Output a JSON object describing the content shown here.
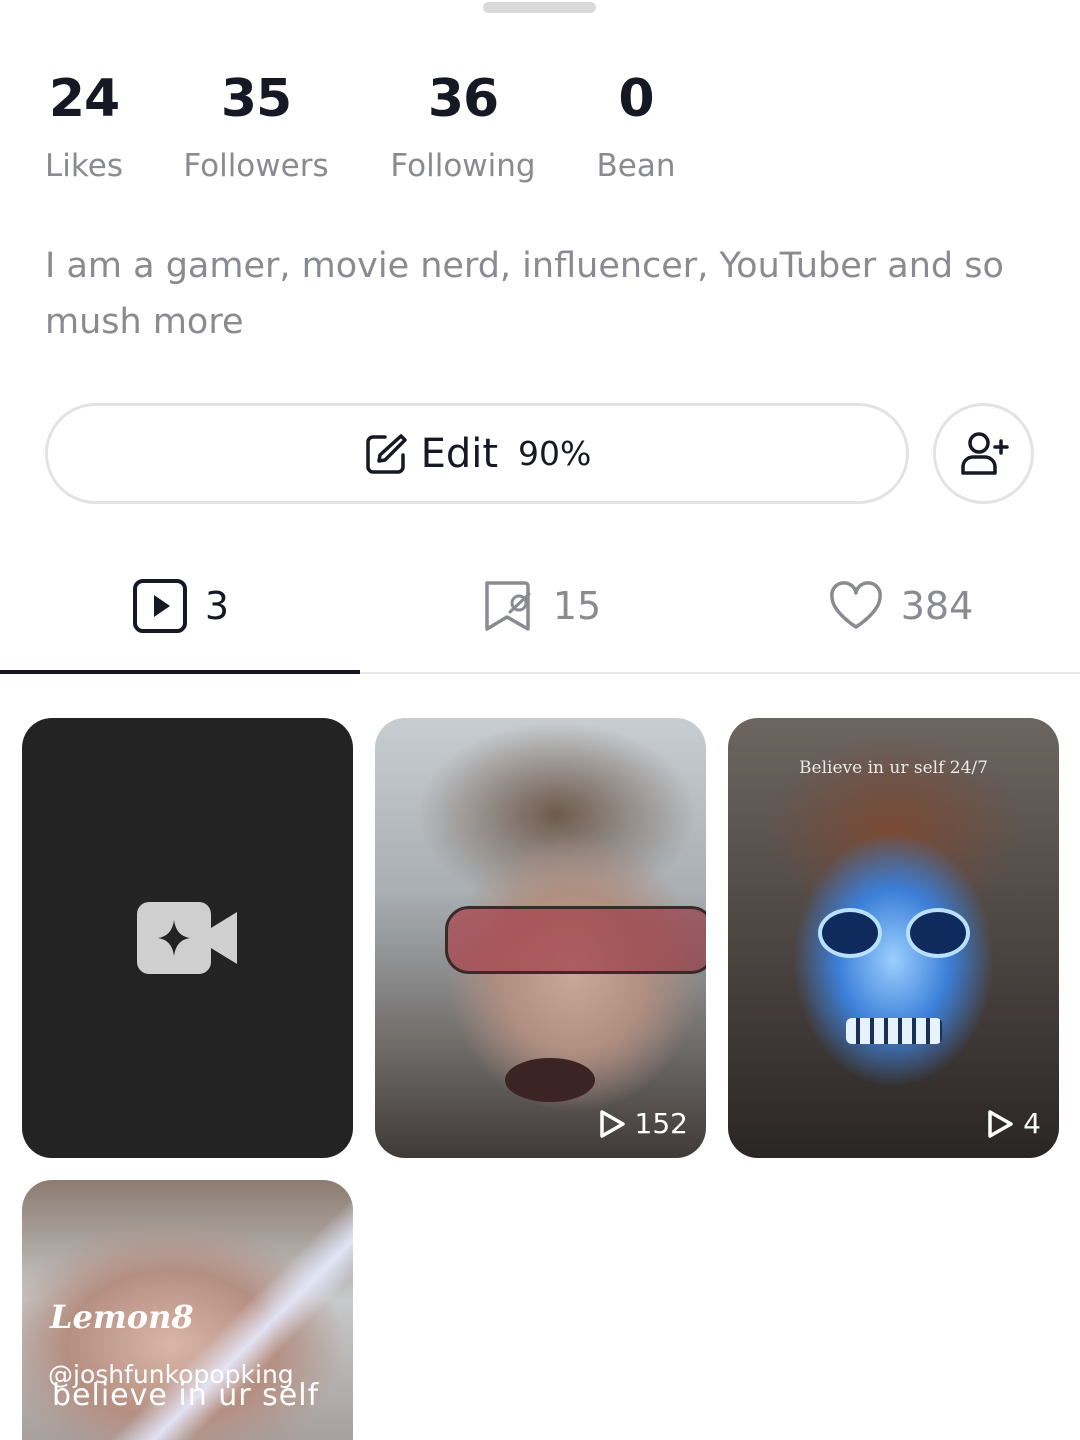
{
  "stats": [
    {
      "value": "24",
      "label": "Likes"
    },
    {
      "value": "35",
      "label": "Followers"
    },
    {
      "value": "36",
      "label": "Following"
    },
    {
      "value": "0",
      "label": "Bean"
    }
  ],
  "bio": "I am a gamer, movie nerd, influencer, YouTuber and so mush more",
  "actions": {
    "edit_label": "Edit",
    "edit_progress": "90%",
    "edit_icon": "edit-icon",
    "add_friend_icon": "add-friend-icon"
  },
  "tabs": [
    {
      "icon": "video-icon",
      "count": "3",
      "active": true
    },
    {
      "icon": "saved-icon",
      "count": "15",
      "active": false
    },
    {
      "icon": "heart-icon",
      "count": "384",
      "active": false
    }
  ],
  "grid": {
    "create_icon": "create-video-icon",
    "items": [
      {
        "views": "152"
      },
      {
        "views": "4",
        "caption": "Believe in ur self 24/7"
      },
      {
        "brand": "Lemon8",
        "handle": "@joshfunkopopking",
        "slogan": "believe in ur self"
      }
    ]
  },
  "colors": {
    "primary_text": "#161823",
    "secondary_text": "#8a8b91",
    "border": "#e3e3e4",
    "thumb_dark": "#232323"
  }
}
